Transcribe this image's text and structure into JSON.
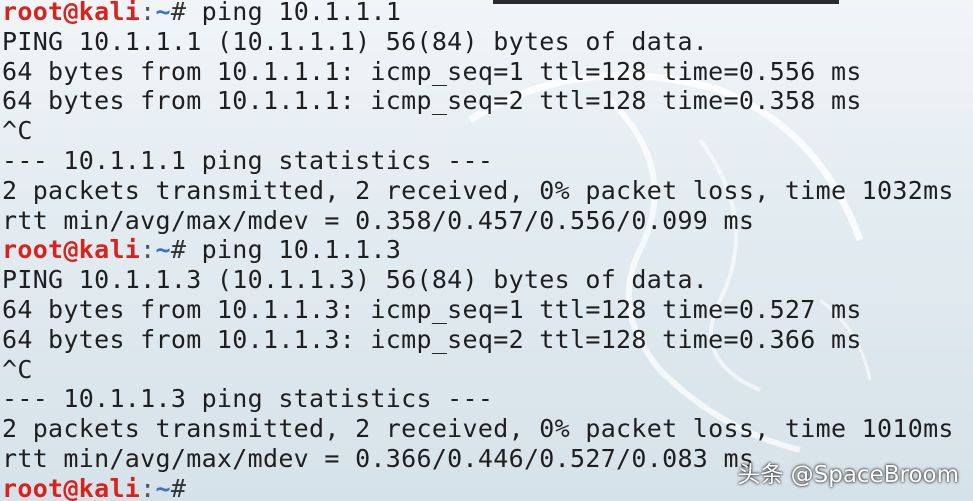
{
  "prompt": {
    "user": "root@kali",
    "sep": ":",
    "path": "~",
    "symbol": "#"
  },
  "session1": {
    "command": " ping 10.1.1.1",
    "header": "PING 10.1.1.1 (10.1.1.1) 56(84) bytes of data.",
    "reply1": "64 bytes from 10.1.1.1: icmp_seq=1 ttl=128 time=0.556 ms",
    "reply2": "64 bytes from 10.1.1.1: icmp_seq=2 ttl=128 time=0.358 ms",
    "interrupt": "^C",
    "stats_header": "--- 10.1.1.1 ping statistics ---",
    "stats_packets": "2 packets transmitted, 2 received, 0% packet loss, time 1032ms",
    "stats_rtt": "rtt min/avg/max/mdev = 0.358/0.457/0.556/0.099 ms"
  },
  "session2": {
    "command": " ping 10.1.1.3",
    "header": "PING 10.1.1.3 (10.1.1.3) 56(84) bytes of data.",
    "reply1": "64 bytes from 10.1.1.3: icmp_seq=1 ttl=128 time=0.527 ms",
    "reply2": "64 bytes from 10.1.1.3: icmp_seq=2 ttl=128 time=0.366 ms",
    "interrupt": "^C",
    "stats_header": "--- 10.1.1.3 ping statistics ---",
    "stats_packets": "2 packets transmitted, 2 received, 0% packet loss, time 1010ms",
    "stats_rtt": "rtt min/avg/max/mdev = 0.366/0.446/0.527/0.083 ms"
  },
  "watermark": "头条 @SpaceBroom",
  "colors": {
    "user": "#d8221c",
    "path": "#3a6fd0",
    "text": "#1f1f1f",
    "background": "#e3ecf1"
  }
}
